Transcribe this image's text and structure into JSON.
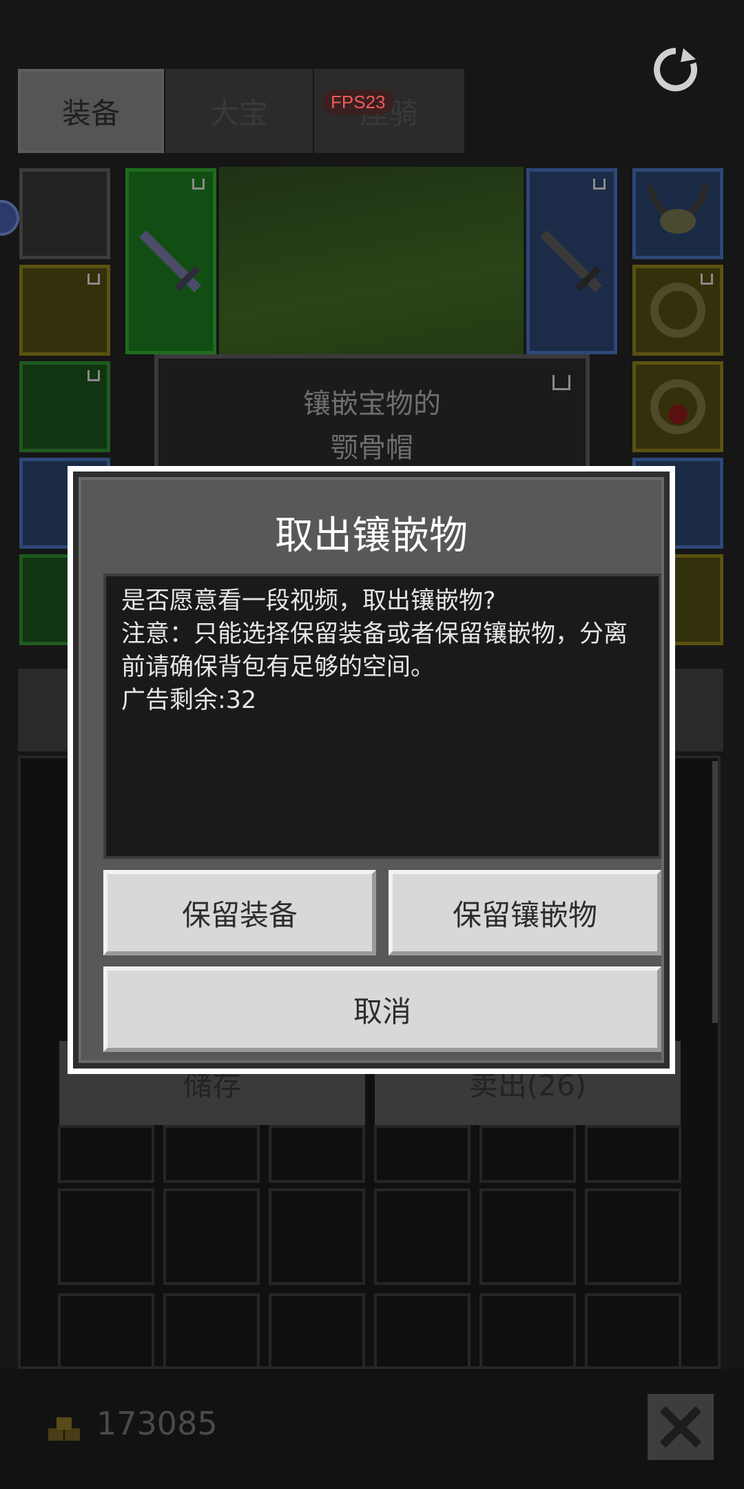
{
  "header": {
    "tabs": [
      {
        "label": "装备"
      },
      {
        "label": "大宝"
      },
      {
        "label": "座骑"
      }
    ],
    "fps_badge": "FPS23",
    "refresh_icon": "refresh-icon"
  },
  "equipment": {
    "tooltip_line1": "镶嵌宝物的",
    "tooltip_line2": "颚骨帽"
  },
  "bag": {
    "store_label": "储存",
    "sell_label": "卖出(26)"
  },
  "footer": {
    "gold_amount": "173085",
    "coin_icon": "coin-icon",
    "close_icon": "close-icon"
  },
  "dialog": {
    "title": "取出镶嵌物",
    "message_lines": [
      "是否愿意看一段视频，取出镶嵌物?",
      "注意：只能选择保留装备或者保留镶嵌物，分离前请确保背包有足够的空间。",
      "广告剩余:32"
    ],
    "keep_equipment_label": "保留装备",
    "keep_inlay_label": "保留镶嵌物",
    "cancel_label": "取消"
  },
  "colors": {
    "dialog_border": "#ffffff",
    "dialog_panel": "#585858",
    "button_bg": "#d8d8d8",
    "fps_text": "#f05a5a"
  }
}
